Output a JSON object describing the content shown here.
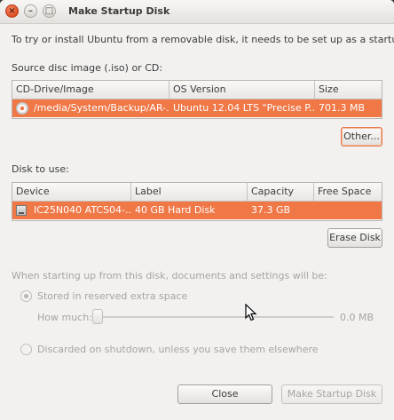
{
  "window": {
    "title": "Make Startup Disk",
    "controls": {
      "close": "×",
      "minimize": "–",
      "maximize": "□"
    }
  },
  "intro_text": "To try or install Ubuntu from a removable disk, it needs to be set up as a startup disk.",
  "source": {
    "label": "Source disc image (.iso) or CD:",
    "columns": [
      "CD-Drive/Image",
      "OS Version",
      "Size"
    ],
    "rows": [
      {
        "image": "/media/System/Backup/AR-...",
        "os_version": "Ubuntu 12.04 LTS \"Precise P...",
        "size": "701.3 MB",
        "icon": "cd-icon"
      }
    ],
    "other_button": "Other..."
  },
  "disk": {
    "label": "Disk to use:",
    "columns": [
      "Device",
      "Label",
      "Capacity",
      "Free Space"
    ],
    "rows": [
      {
        "device": "IC25N040 ATCS04-...",
        "label": "40 GB Hard Disk",
        "capacity": "37.3 GB",
        "free_space": "",
        "icon": "hard-disk-icon"
      }
    ],
    "erase_button": "Erase Disk"
  },
  "storage": {
    "heading": "When starting up from this disk, documents and settings will be:",
    "option_stored": "Stored in reserved extra space",
    "how_much_label": "How much:",
    "how_much_value": "0.0 MB",
    "slider_fraction": 0,
    "option_discarded": "Discarded on shutdown, unless you save them elsewhere",
    "selected_option": "stored",
    "enabled": false
  },
  "footer": {
    "close_button": "Close",
    "make_button": "Make Startup Disk"
  },
  "colors": {
    "selection": "#f07746",
    "close_button": "#df4b20",
    "disabled_text": "#a8a49f"
  }
}
